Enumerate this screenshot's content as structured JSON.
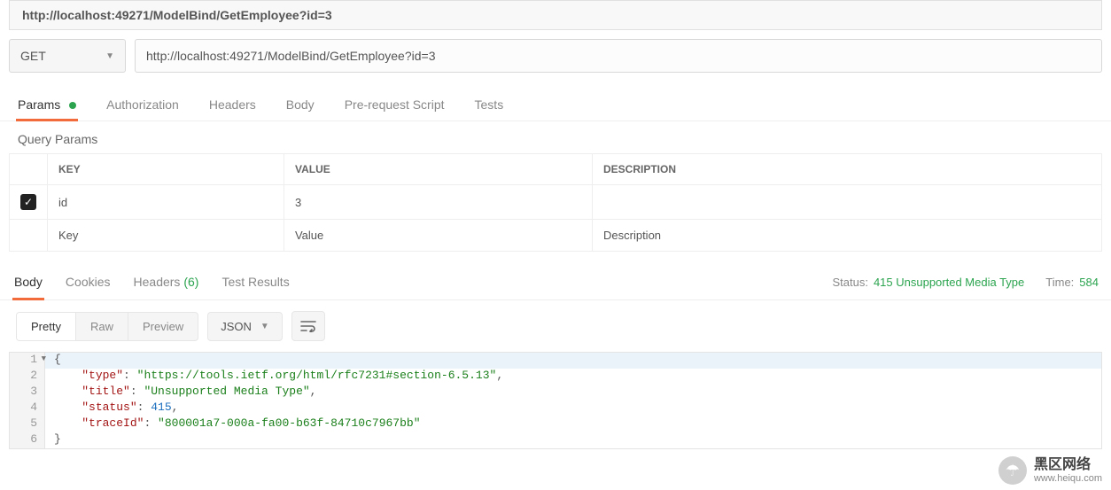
{
  "title": "http://localhost:49271/ModelBind/GetEmployee?id=3",
  "request": {
    "method": "GET",
    "url": "http://localhost:49271/ModelBind/GetEmployee?id=3"
  },
  "tabs": {
    "params": "Params",
    "authorization": "Authorization",
    "headers": "Headers",
    "body": "Body",
    "prerequest": "Pre-request Script",
    "tests": "Tests"
  },
  "params_section": {
    "title": "Query Params",
    "columns": {
      "key": "KEY",
      "value": "VALUE",
      "description": "DESCRIPTION"
    },
    "rows": [
      {
        "enabled": true,
        "key": "id",
        "value": "3",
        "description": ""
      }
    ],
    "placeholders": {
      "key": "Key",
      "value": "Value",
      "description": "Description"
    }
  },
  "response_tabs": {
    "body": "Body",
    "cookies": "Cookies",
    "headers_label": "Headers",
    "headers_count": "(6)",
    "test_results": "Test Results"
  },
  "response_meta": {
    "status_label": "Status:",
    "status_value": "415 Unsupported Media Type",
    "time_label": "Time:",
    "time_value": "584"
  },
  "view_toolbar": {
    "pretty": "Pretty",
    "raw": "Raw",
    "preview": "Preview",
    "format": "JSON"
  },
  "response_body": {
    "type_key": "\"type\"",
    "type_val": "\"https://tools.ietf.org/html/rfc7231#section-6.5.13\"",
    "title_key": "\"title\"",
    "title_val": "\"Unsupported Media Type\"",
    "status_key": "\"status\"",
    "status_val": "415",
    "trace_key": "\"traceId\"",
    "trace_val": "\"800001a7-000a-fa00-b63f-84710c7967bb\""
  },
  "watermark": {
    "line1": "黑区网络",
    "line2": "www.heiqu.com"
  }
}
